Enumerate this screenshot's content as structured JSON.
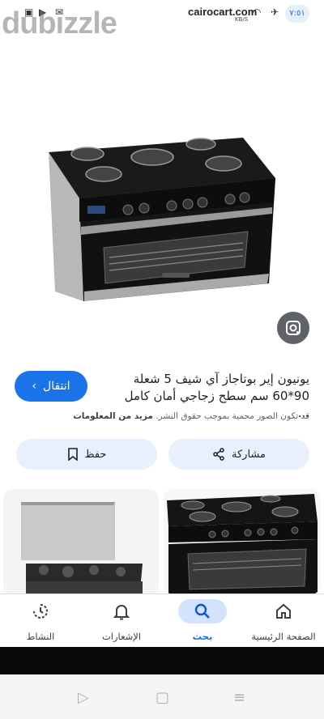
{
  "status": {
    "site": "cairocart.com",
    "speed": "KB/S",
    "time": "٧:٥١"
  },
  "watermark": {
    "text": "dubizzle"
  },
  "product": {
    "title_line1": "يونيون إير بوتاجاز آي شيف 5 شعلة",
    "title_line2": "90*60 سم سطح زجاجي أمان كامل ...",
    "visit_label": "انتقال",
    "copyright": "قد تكون الصور محمية بموجب حقوق النشر.",
    "more_info": "مزيد من المعلومات"
  },
  "actions": {
    "share_label": "مشاركة",
    "save_label": "حفظ"
  },
  "bottom_nav": {
    "activity": "النشاط",
    "notifications": "الإشعارات",
    "search": "بحث",
    "home": "الصفحة الرئيسية"
  },
  "colors": {
    "accent": "#1a73e8",
    "chip_bg": "#e8f0fe",
    "active_nav_bg": "#d3e3fd"
  }
}
